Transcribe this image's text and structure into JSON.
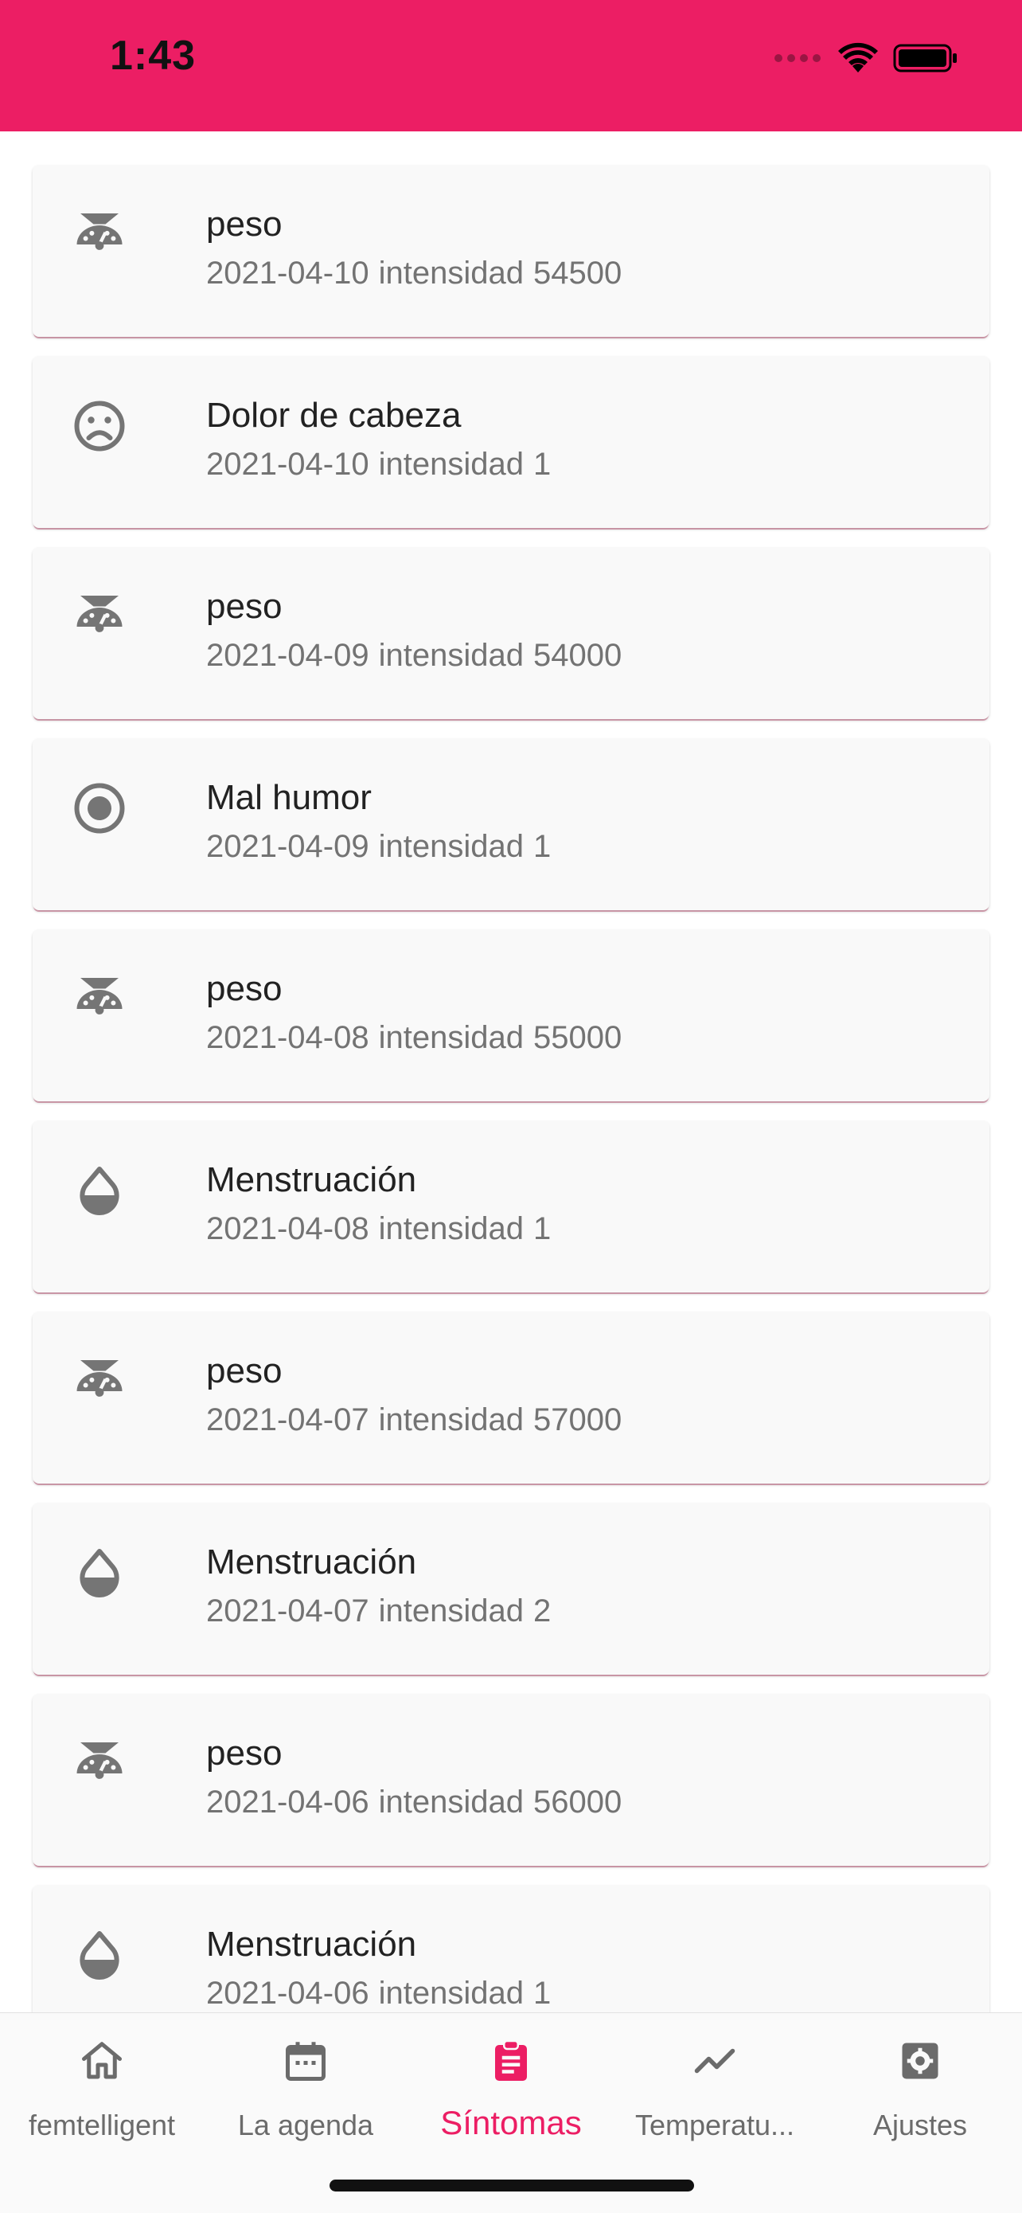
{
  "status_bar": {
    "time": "1:43",
    "background": "#EC1E64"
  },
  "symptoms": [
    {
      "icon": "scale-icon",
      "title": "peso",
      "date": "2021-04-10",
      "label": "intensidad",
      "value": "54500"
    },
    {
      "icon": "sad-face-icon",
      "title": "Dolor de cabeza",
      "date": "2021-04-10",
      "label": "intensidad",
      "value": "1"
    },
    {
      "icon": "scale-icon",
      "title": "peso",
      "date": "2021-04-09",
      "label": "intensidad",
      "value": "54000"
    },
    {
      "icon": "radio-button-icon",
      "title": "Mal humor",
      "date": "2021-04-09",
      "label": "intensidad",
      "value": "1"
    },
    {
      "icon": "scale-icon",
      "title": "peso",
      "date": "2021-04-08",
      "label": "intensidad",
      "value": "55000"
    },
    {
      "icon": "drop-icon",
      "title": "Menstruación",
      "date": "2021-04-08",
      "label": "intensidad",
      "value": "1"
    },
    {
      "icon": "scale-icon",
      "title": "peso",
      "date": "2021-04-07",
      "label": "intensidad",
      "value": "57000"
    },
    {
      "icon": "drop-icon",
      "title": "Menstruación",
      "date": "2021-04-07",
      "label": "intensidad",
      "value": "2"
    },
    {
      "icon": "scale-icon",
      "title": "peso",
      "date": "2021-04-06",
      "label": "intensidad",
      "value": "56000"
    },
    {
      "icon": "drop-icon",
      "title": "Menstruación",
      "date": "2021-04-06",
      "label": "intensidad",
      "value": "1"
    }
  ],
  "nav": {
    "active": "Síntomas",
    "active_color": "#EC1E64",
    "items": [
      {
        "icon": "home-icon",
        "label": "femtelligent"
      },
      {
        "icon": "calendar-icon",
        "label": "La agenda"
      },
      {
        "icon": "clipboard-icon",
        "label": "Síntomas"
      },
      {
        "icon": "trending-line-icon",
        "label": "Temperatu..."
      },
      {
        "icon": "settings-icon",
        "label": "Ajustes"
      }
    ]
  }
}
